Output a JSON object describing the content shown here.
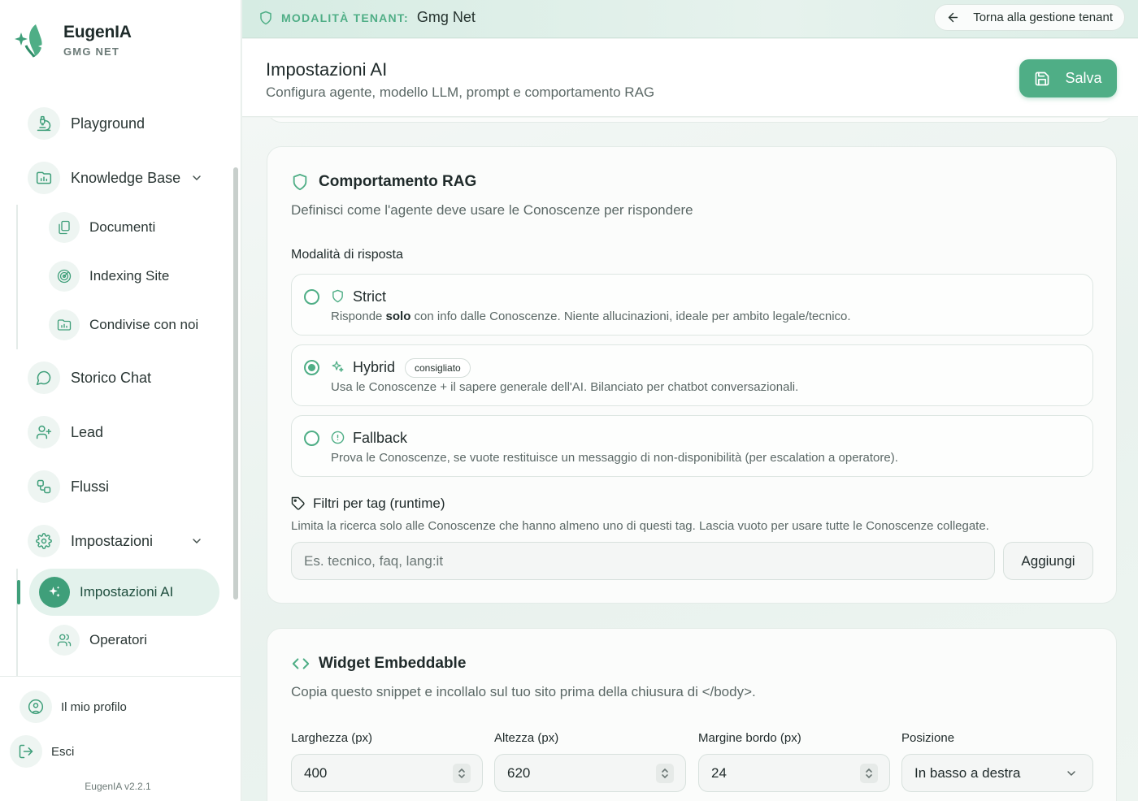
{
  "brand": {
    "name": "EugenIA",
    "subtitle": "GMG NET"
  },
  "sidebar": {
    "items": [
      {
        "label": "Playground",
        "icon": "microscope-icon"
      },
      {
        "label": "Knowledge Base",
        "icon": "folder-chart-icon"
      },
      {
        "label": "Documenti",
        "icon": "documents-icon"
      },
      {
        "label": "Indexing Site",
        "icon": "radar-icon"
      },
      {
        "label": "Condivise con noi",
        "icon": "shared-folder-icon"
      },
      {
        "label": "Storico Chat",
        "icon": "chat-bubble-icon"
      },
      {
        "label": "Lead",
        "icon": "user-plus-icon"
      },
      {
        "label": "Flussi",
        "icon": "workflow-icon"
      },
      {
        "label": "Impostazioni",
        "icon": "gear-icon"
      },
      {
        "label": "Impostazioni AI",
        "icon": "sparkles-icon",
        "active": true
      },
      {
        "label": "Operatori",
        "icon": "users-icon"
      }
    ],
    "bottom": {
      "profile": "Il mio profilo",
      "logout": "Esci",
      "version": "EugenIA v2.2.1"
    }
  },
  "tenant_bar": {
    "label": "MODALITÀ TENANT:",
    "value": "Gmg Net",
    "back_button": "Torna alla gestione tenant"
  },
  "header": {
    "title": "Impostazioni AI",
    "subtitle": "Configura agente, modello LLM, prompt e comportamento RAG",
    "save_label": "Salva"
  },
  "rag": {
    "title": "Comportamento RAG",
    "description": "Definisci come l'agente deve usare le Conoscenze per rispondere",
    "mode_label": "Modalità di risposta",
    "options": [
      {
        "title": "Strict",
        "desc_before": "Risponde ",
        "desc_bold": "solo",
        "desc_after": " con info dalle Conoscenze. Niente allucinazioni, ideale per ambito legale/tecnico.",
        "selected": false
      },
      {
        "title": "Hybrid",
        "badge": "consigliato",
        "desc": "Usa le Conoscenze + il sapere generale dell'AI. Bilanciato per chatbot conversazionali.",
        "selected": true
      },
      {
        "title": "Fallback",
        "desc": "Prova le Conoscenze, se vuote restituisce un messaggio di non-disponibilità (per escalation a operatore).",
        "selected": false
      }
    ],
    "tags": {
      "title": "Filtri per tag (runtime)",
      "description": "Limita la ricerca solo alle Conoscenze che hanno almeno uno di questi tag. Lascia vuoto per usare tutte le Conoscenze collegate.",
      "placeholder": "Es. tecnico, faq, lang:it",
      "add_label": "Aggiungi"
    }
  },
  "widget": {
    "title": "Widget Embeddable",
    "description": "Copia questo snippet e incollalo sul tuo sito prima della chiusura di </body>.",
    "fields": [
      {
        "label": "Larghezza (px)",
        "value": "400"
      },
      {
        "label": "Altezza (px)",
        "value": "620"
      },
      {
        "label": "Margine bordo (px)",
        "value": "24"
      },
      {
        "label": "Posizione",
        "value": "In basso a destra"
      }
    ]
  },
  "colors": {
    "accent": "#4fae86",
    "accent_dark": "#3f9f7a",
    "active_bg": "#e3f2ec"
  }
}
